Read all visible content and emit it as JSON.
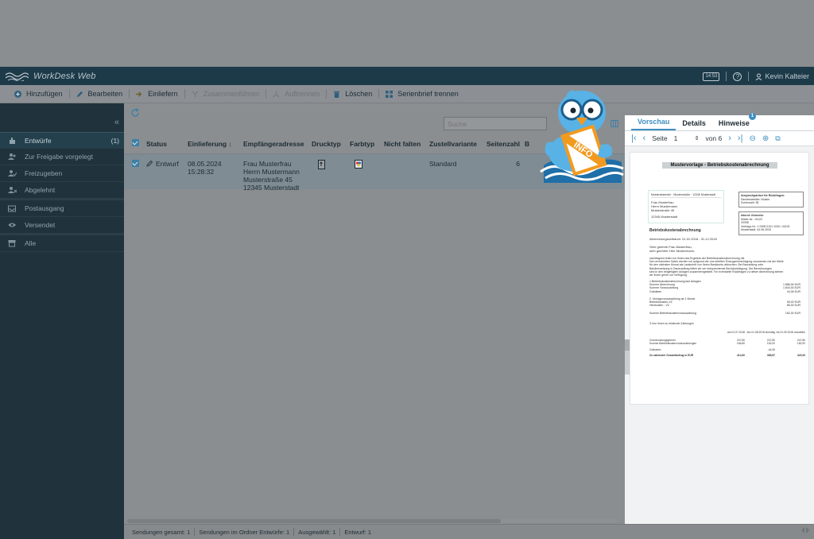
{
  "app": {
    "name": "WorkDesk Web",
    "clock": "14:53",
    "help": "?",
    "user": "Kevin Kalteier"
  },
  "toolbar": [
    {
      "label": "Hinzufügen",
      "icon": "plus-circle-icon",
      "disabled": false
    },
    {
      "label": "Bearbeiten",
      "icon": "pencil-icon",
      "disabled": false
    },
    {
      "label": "Einliefern",
      "icon": "deliver-icon",
      "disabled": false
    },
    {
      "label": "Zusammenführen",
      "icon": "merge-icon",
      "disabled": true
    },
    {
      "label": "Auftrennen",
      "icon": "split-icon",
      "disabled": true
    },
    {
      "label": "Löschen",
      "icon": "trash-icon",
      "disabled": false
    },
    {
      "label": "Serienbrief trennen",
      "icon": "grid-icon",
      "disabled": false
    }
  ],
  "sidebar": {
    "items": [
      {
        "label": "Entwürfe",
        "count": "(1)",
        "icon": "hand-icon",
        "active": true
      },
      {
        "label": "Zur Freigabe vorgelegt",
        "count": "",
        "icon": "users-icon",
        "active": false
      },
      {
        "label": "Freizugeben",
        "count": "",
        "icon": "users-check-icon",
        "active": false
      },
      {
        "label": "Abgelehnt",
        "count": "",
        "icon": "users-x-icon",
        "active": false
      },
      {
        "label": "Postausgang",
        "count": "",
        "icon": "outbox-icon",
        "active": false
      },
      {
        "label": "Versendet",
        "count": "",
        "icon": "eye-icon",
        "active": false
      },
      {
        "label": "Alle",
        "count": "",
        "icon": "archive-icon",
        "active": false
      }
    ]
  },
  "search": {
    "placeholder": "Suche"
  },
  "table": {
    "headers": [
      "Status",
      "Einlieferung ↓",
      "Empfängeradresse",
      "Drucktyp",
      "Farbtyp",
      "Nicht falten",
      "Zustellvariante",
      "Seitenzahl",
      "B"
    ],
    "rows": [
      {
        "status": "Entwurf",
        "date": "08.05.2024",
        "time": "15:28:32",
        "address": [
          "Frau Musterfrau",
          "Herrn Mustermann",
          "Musterstraße 45",
          "12345 Musterstadt"
        ],
        "zustellvariante": "Standard",
        "seitenzahl": "6"
      }
    ]
  },
  "statusbar": [
    "Sendungen gesamt: 1",
    "Sendungen im Ordner Entwürfe: 1",
    "Ausgewählt: 1",
    "Entwurf: 1"
  ],
  "preview": {
    "tabs": [
      "Vorschau",
      "Details",
      "Hinweise"
    ],
    "hinweise_badge": "1",
    "page_label": "Seite",
    "page": "1",
    "of_label": "von 6",
    "doc": {
      "title": "Mustervorlage - Betriebskostenabrechnung",
      "sender_line": "Musterabsender · Musterstraße · 12345 Musterstadt",
      "recipient": [
        "Frau Musterfrau",
        "Herrn Mustermann",
        "Musterstraße 45",
        "",
        "12345 Musterstadt"
      ],
      "contact_box": [
        "Ansprechpartner für Rückfragen:",
        "Sachbearbeiter: Muster",
        "Durchwahl: 38"
      ],
      "info_box": [
        "Interne Vermerke",
        "Mieter-Nr.: 19122",
        "20398",
        "Vertrags-Nr.: 1 0008 0101 1034 / 44192",
        "Musterstadt, 04.06.2018"
      ],
      "heading": "Betriebskostenabrechnung",
      "period": "Abrechnungszeitraum: 01.01.2018 - 31.12.2018",
      "greeting": [
        "Sehr geehrte Frau Musterfrau,",
        "sehr geehrter Herr Mustermann,"
      ],
      "body": [
        "nachfolgend teilen wir Ihnen das Ergebnis der Betriebskostenabrechnung mit.",
        "Den errechneten Saldo werden wir aufgrund der uns erteilten Einzugsermächtigung zusammen mit der Miete",
        "für den nächsten Monat als Lastschrift von Ihrem Bankkonto abbuchen. Bei Barzahlung oder",
        "Barüberweisung in Dauerauftrag bitten wir um entsprechende Berücksichtigung. Die Berechnungen",
        "sind in den beigefügten Anlagen zusammengestellt. Für eventuelle Rückfragen zu dieser Abrechnung stehen",
        "wir Ihnen gerne zur Verfügung."
      ],
      "section1": [
        "1.Betriebskostenabrechnung laut Anlagen",
        "Summe Abrechnung",
        "Summe Vorauszahlung",
        "Guthaben"
      ],
      "section1_values": [
        "",
        "1.888,94 EUR",
        "1.844,00 EUR",
        "44,06 EUR"
      ],
      "section2": [
        "2. Umlagevorauszahlung ab 1 Monat",
        "Betriebskosten-VZ",
        "Heizkosten - VZ"
      ],
      "section2_values": [
        "",
        "96,00 EUR",
        "86,00 EUR"
      ],
      "sum_vz": "Summe Betriebskostenvorauszahlung",
      "sum_vz_value": "182,00 EUR",
      "section3": "3.Von Ihnen zu leistende Zahlungen",
      "cols": [
        "am 01.07.2018",
        "Am 01.08.2018 einmalig",
        "Ab 01.09.2018 monatlich"
      ],
      "rows": [
        [
          "Grundnutzungsgebühr",
          "247,80",
          "247,80",
          "247,80"
        ],
        [
          "Summe Betriebskostenvorauszahlungen",
          "166,80",
          "182,00",
          "182,00"
        ],
        [
          "Guthaben",
          "",
          "-44,06",
          ""
        ],
        [
          "Zu zahlender Gesamtbetrag in EUR",
          "414,60",
          "385,87",
          "429,93"
        ]
      ]
    }
  },
  "mascot": {
    "sign_text": "INFO"
  }
}
